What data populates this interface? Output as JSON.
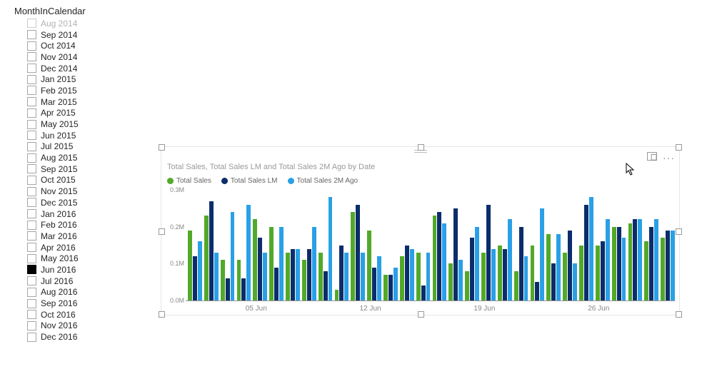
{
  "slicer": {
    "title": "MonthInCalendar",
    "items": [
      {
        "label": "Aug 2014",
        "selected": false,
        "dim": true
      },
      {
        "label": "Sep 2014",
        "selected": false
      },
      {
        "label": "Oct 2014",
        "selected": false
      },
      {
        "label": "Nov 2014",
        "selected": false
      },
      {
        "label": "Dec 2014",
        "selected": false
      },
      {
        "label": "Jan 2015",
        "selected": false
      },
      {
        "label": "Feb 2015",
        "selected": false
      },
      {
        "label": "Mar 2015",
        "selected": false
      },
      {
        "label": "Apr 2015",
        "selected": false
      },
      {
        "label": "May 2015",
        "selected": false
      },
      {
        "label": "Jun 2015",
        "selected": false
      },
      {
        "label": "Jul 2015",
        "selected": false
      },
      {
        "label": "Aug 2015",
        "selected": false
      },
      {
        "label": "Sep 2015",
        "selected": false
      },
      {
        "label": "Oct 2015",
        "selected": false
      },
      {
        "label": "Nov 2015",
        "selected": false
      },
      {
        "label": "Dec 2015",
        "selected": false
      },
      {
        "label": "Jan 2016",
        "selected": false
      },
      {
        "label": "Feb 2016",
        "selected": false
      },
      {
        "label": "Mar 2016",
        "selected": false
      },
      {
        "label": "Apr 2016",
        "selected": false
      },
      {
        "label": "May 2016",
        "selected": false
      },
      {
        "label": "Jun 2016",
        "selected": true
      },
      {
        "label": "Jul 2016",
        "selected": false
      },
      {
        "label": "Aug 2016",
        "selected": false
      },
      {
        "label": "Sep 2016",
        "selected": false
      },
      {
        "label": "Oct 2016",
        "selected": false
      },
      {
        "label": "Nov 2016",
        "selected": false
      },
      {
        "label": "Dec 2016",
        "selected": false
      }
    ]
  },
  "visual": {
    "title": "Total Sales, Total Sales LM and Total Sales 2M Ago by Date",
    "legend": [
      {
        "name": "Total Sales",
        "color": "#52a929"
      },
      {
        "name": "Total Sales LM",
        "color": "#0b2d6b"
      },
      {
        "name": "Total Sales 2M Ago",
        "color": "#2aa0e6"
      }
    ],
    "yticks": [
      "0.0M",
      "0.1M",
      "0.2M",
      "0.3M"
    ],
    "xticks": [
      "05 Jun",
      "12 Jun",
      "19 Jun",
      "26 Jun"
    ]
  },
  "chart_data": {
    "type": "bar",
    "title": "Total Sales, Total Sales LM and Total Sales 2M Ago by Date",
    "ylabel": "",
    "xlabel": "",
    "ylim": [
      0,
      0.3
    ],
    "yticks": [
      0.0,
      0.1,
      0.2,
      0.3
    ],
    "xtick_labels": [
      "05 Jun",
      "12 Jun",
      "19 Jun",
      "26 Jun"
    ],
    "categories": [
      "01 Jun",
      "02 Jun",
      "03 Jun",
      "04 Jun",
      "05 Jun",
      "06 Jun",
      "07 Jun",
      "08 Jun",
      "09 Jun",
      "10 Jun",
      "11 Jun",
      "12 Jun",
      "13 Jun",
      "14 Jun",
      "15 Jun",
      "16 Jun",
      "17 Jun",
      "18 Jun",
      "19 Jun",
      "20 Jun",
      "21 Jun",
      "22 Jun",
      "23 Jun",
      "24 Jun",
      "25 Jun",
      "26 Jun",
      "27 Jun",
      "28 Jun",
      "29 Jun",
      "30 Jun"
    ],
    "series": [
      {
        "name": "Total Sales",
        "color": "#52a929",
        "values": [
          0.19,
          0.23,
          0.11,
          0.11,
          0.22,
          0.2,
          0.13,
          0.11,
          0.13,
          0.03,
          0.24,
          0.19,
          0.07,
          0.12,
          0.13,
          0.23,
          0.1,
          0.08,
          0.13,
          0.15,
          0.08,
          0.15,
          0.18,
          0.13,
          0.15,
          0.15,
          0.2,
          0.21,
          0.16,
          0.17
        ]
      },
      {
        "name": "Total Sales LM",
        "color": "#0b2d6b",
        "values": [
          0.12,
          0.27,
          0.06,
          0.06,
          0.17,
          0.09,
          0.14,
          0.14,
          0.08,
          0.15,
          0.26,
          0.09,
          0.07,
          0.15,
          0.04,
          0.24,
          0.25,
          0.17,
          0.26,
          0.14,
          0.2,
          0.05,
          0.1,
          0.19,
          0.26,
          0.16,
          0.2,
          0.22,
          0.2,
          0.19
        ]
      },
      {
        "name": "Total Sales 2M Ago",
        "color": "#2aa0e6",
        "values": [
          0.16,
          0.13,
          0.24,
          0.26,
          0.13,
          0.2,
          0.14,
          0.2,
          0.28,
          0.13,
          0.13,
          0.12,
          0.09,
          0.14,
          0.13,
          0.21,
          0.11,
          0.2,
          0.14,
          0.22,
          0.12,
          0.25,
          0.18,
          0.1,
          0.28,
          0.22,
          0.17,
          0.22,
          0.22,
          0.19
        ]
      }
    ]
  }
}
